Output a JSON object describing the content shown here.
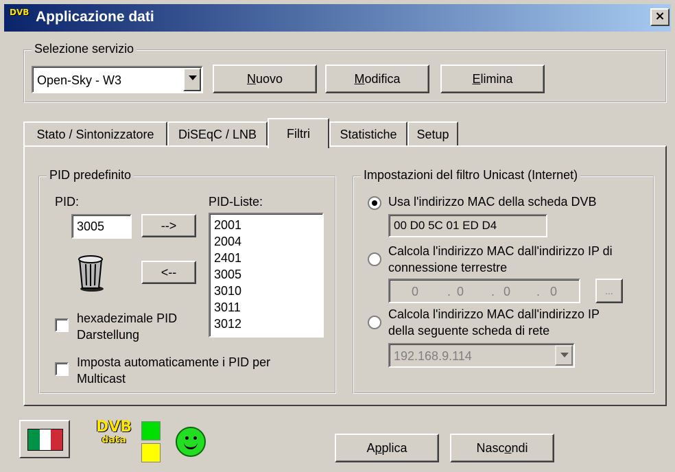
{
  "window": {
    "title": "Applicazione dati",
    "app_icon_text": "DVB",
    "close_glyph": "×"
  },
  "service": {
    "group_title": "Selezione servizio",
    "selected": "Open-Sky  - W3",
    "buttons": [
      {
        "mnemonic": "N",
        "rest": "uovo"
      },
      {
        "mnemonic": "M",
        "rest": "odifica"
      },
      {
        "mnemonic": "E",
        "rest": "limina"
      }
    ]
  },
  "tabs": [
    {
      "label": "Stato / Sintonizzatore",
      "active": false
    },
    {
      "label": "DiSEqC / LNB",
      "active": false
    },
    {
      "label": "Filtri",
      "active": true
    },
    {
      "label": "Statistiche",
      "active": false
    },
    {
      "label": "Setup",
      "active": false
    }
  ],
  "pid": {
    "group_title": "PID predefinito",
    "pid_label": "PID:",
    "pid_value": "3005",
    "list_label": "PID-Liste:",
    "add_button": "-->",
    "remove_button": "<--",
    "list": [
      "2001",
      "2004",
      "2401",
      "3005",
      "3010",
      "3011",
      "3012"
    ],
    "hex_checkbox": {
      "line1": "hexadezimale PID",
      "line2": "Darstellung",
      "checked": false
    },
    "multicast_checkbox": {
      "line1": "Imposta automaticamente i PID per",
      "line2": "Multicast",
      "checked": false
    }
  },
  "unicast": {
    "group_title": "Impostazioni del filtro Unicast (Internet)",
    "option1": {
      "label": "Usa l'indirizzo MAC della scheda DVB",
      "checked": true
    },
    "mac_value": "00 D0 5C 01 ED D4",
    "option2": {
      "line1": "Calcola l'indirizzo MAC dall'indirizzo IP di",
      "line2": "connessione terrestre",
      "checked": false
    },
    "ip_octets": [
      "0",
      "0",
      "0",
      "0"
    ],
    "ip_dot": ".",
    "browse_button": "...",
    "option3": {
      "line1": "Calcola l'indirizzo MAC dall'indirizzo IP",
      "line2": "della seguente scheda di rete",
      "checked": false
    },
    "adapter_ip": "192.168.9.114"
  },
  "footer": {
    "logo_top": "DVB",
    "logo_bottom": "data",
    "apply": {
      "before": "A",
      "mnemonic": "p",
      "after": "plica"
    },
    "hide": {
      "before": "Nasc",
      "mnemonic": "o",
      "after": "ndi"
    }
  },
  "colors": {
    "face": "#d4d0c8",
    "title_start": "#0a246a",
    "title_end": "#a6caf0",
    "led_top": "#00e000",
    "led_bottom": "#ffff00",
    "flag_green": "#009246",
    "flag_white": "#ffffff",
    "flag_red": "#ce2b37"
  }
}
